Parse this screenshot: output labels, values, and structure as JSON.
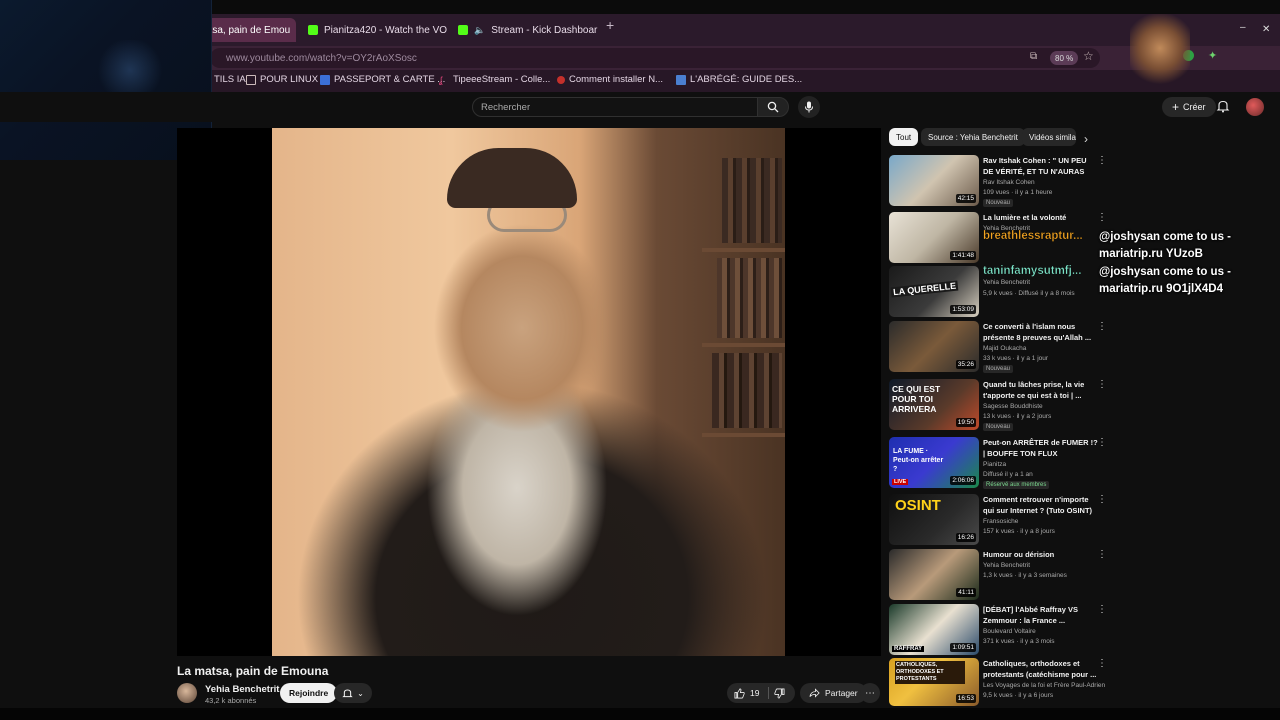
{
  "browser": {
    "tabs": [
      {
        "label": "atsa, pain de Emou",
        "active": true
      },
      {
        "label": "Pianitza420 - Watch the VO",
        "active": false
      },
      {
        "label": "Stream - Kick Dashboar",
        "active": false
      }
    ],
    "address": "www.youtube.com/watch?v=OY2rAoXSosc",
    "zoom": "80 %",
    "bookmarks": [
      {
        "label": "TILS IA",
        "icon": "folder-icon"
      },
      {
        "label": "POUR LINUX",
        "icon": "folder-icon"
      },
      {
        "label": "PASSEPORT & CARTE ...",
        "icon": "page-icon"
      },
      {
        "label": "TipeeeStream - Colle...",
        "icon": "tipeee-icon"
      },
      {
        "label": "Comment installer N...",
        "icon": "youtube-icon"
      },
      {
        "label": "L'ABRÉGÉ: GUIDE DES...",
        "icon": "book-icon"
      }
    ],
    "colors": {
      "tabbar": "#2b1a2b",
      "active_tab": "#5a2c4a",
      "kick_green": "#53fc18"
    }
  },
  "youtube": {
    "search_placeholder": "Rechercher",
    "create_label": "Créer",
    "video": {
      "title": "La matsa, pain de Emouna",
      "channel": "Yehia Benchetrit",
      "subscribers": "43,2 k abonnés",
      "join_label": "Rejoindre",
      "likes": "19",
      "share_label": "Partager"
    },
    "chips": [
      "Tout",
      "Source : Yehia Benchetrit",
      "Vidéos simila"
    ],
    "recommendations": [
      {
        "title": "Rav Itshak Cohen : \" UN PEU DE VÉRITÉ, ET TU N'AURAS PLUS ...",
        "channel": "Rav Itshak Cohen",
        "meta": "109 vues · il y a 1 heure",
        "badge": "Nouveau",
        "duration": "42:15"
      },
      {
        "title": "La lumière et la volonté",
        "channel": "Yehia Benchetrit",
        "meta": "",
        "badge": "",
        "duration": "1:41:48"
      },
      {
        "title": "",
        "channel": "Yehia Benchetrit",
        "meta": "5,9 k vues · Diffusé il y a 8 mois",
        "badge": "",
        "duration": "1:53:09"
      },
      {
        "title": "Ce converti à l'islam nous présente 8 preuves qu'Allah ...",
        "channel": "Majid Oukacha",
        "meta": "33 k vues · il y a 1 jour",
        "badge": "Nouveau",
        "duration": "35:26"
      },
      {
        "title": "Quand tu lâches prise, la vie t'apporte ce qui est à toi | ...",
        "channel": "Sagesse Bouddhiste",
        "meta": "13 k vues · il y a 2 jours",
        "badge": "Nouveau",
        "duration": "19:50"
      },
      {
        "title": "Peut-on ARRÊTER de FUMER !? | BOUFFE TON FLUX",
        "channel": "Pianitza",
        "meta": "Diffusé il y a 1 an",
        "badge": "Réservé aux membres",
        "duration": "2:06:06"
      },
      {
        "title": "Comment retrouver n'importe qui sur Internet ? (Tuto OSINT)",
        "channel": "Fransosiche",
        "meta": "157 k vues · il y a 8 jours",
        "badge": "",
        "duration": "16:26"
      },
      {
        "title": "Humour ou dérision",
        "channel": "Yehia Benchetrit",
        "meta": "1,3 k vues · il y a 3 semaines",
        "badge": "",
        "duration": "41:11"
      },
      {
        "title": "[DÉBAT] l'Abbé Raffray VS Zemmour : la France ...",
        "channel": "Boulevard Voltaire",
        "meta": "371 k vues · il y a 3 mois",
        "badge": "",
        "duration": "1:09:51"
      },
      {
        "title": "Catholiques, orthodoxes et protestants (catéchisme pour ...",
        "channel": "Les Voyages de la foi et Frère Paul-Adrien",
        "meta": "9,5 k vues · il y a 6 jours",
        "badge": "",
        "duration": "16:53"
      }
    ],
    "thumbnail_texts": [
      "LA QUERELLE",
      "CE QUI EST POUR TOI ARRIVERA",
      "LA FUME · Peut-on arrêter ?",
      "LIVE",
      "OSINT",
      "RAFFRAY",
      "CATHOLIQUES, ORTHODOXES ET PROTESTANTS"
    ]
  },
  "chat_overlay": {
    "messages": [
      {
        "user": "breathlessraptur...",
        "text": "@joshysan come to us - mariatrip.ru YUzoB",
        "color": "#f5a623"
      },
      {
        "user": "taninfamysutmfj...",
        "text": "@joshysan come to us - mariatrip.ru 9O1jlX4D4",
        "color": "#7de3c8"
      }
    ]
  }
}
